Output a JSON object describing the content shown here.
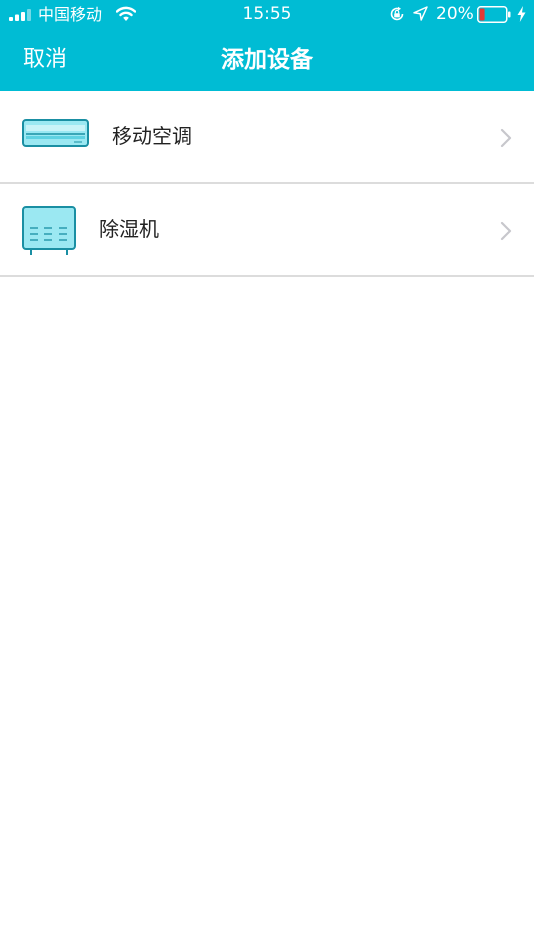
{
  "status_bar": {
    "carrier": "中国移动",
    "time": "15:55",
    "battery_percent": "20%",
    "battery_level": 0.2,
    "icons": [
      "signal-icon",
      "wifi-icon",
      "orientation-lock-icon",
      "location-icon",
      "battery-icon",
      "charging-icon"
    ]
  },
  "nav": {
    "cancel_label": "取消",
    "title": "添加设备"
  },
  "devices": [
    {
      "label": "移动空调",
      "icon": "air-conditioner-icon"
    },
    {
      "label": "除湿机",
      "icon": "dehumidifier-icon"
    }
  ],
  "colors": {
    "accent": "#00bcd4",
    "divider": "#dcdcdc",
    "icon_fill": "#9be8f2",
    "icon_stroke": "#1a8fa3",
    "battery_low": "#e53935"
  }
}
